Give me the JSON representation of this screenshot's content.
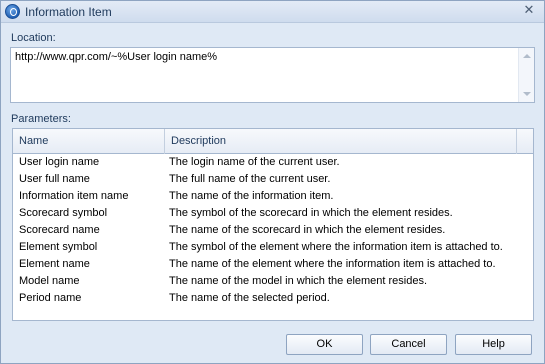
{
  "window": {
    "title": "Information Item"
  },
  "location": {
    "label": "Location:",
    "value": "http://www.qpr.com/~%User login name%"
  },
  "parameters": {
    "label": "Parameters:",
    "columns": {
      "name": "Name",
      "description": "Description"
    },
    "rows": [
      {
        "name": "User login name",
        "description": "The login name of the current user."
      },
      {
        "name": "User full name",
        "description": "The full name of the current user."
      },
      {
        "name": "Information item name",
        "description": "The name of the information item."
      },
      {
        "name": "Scorecard symbol",
        "description": "The symbol of the scorecard in which the element resides."
      },
      {
        "name": "Scorecard name",
        "description": "The name of the scorecard in which the element resides."
      },
      {
        "name": "Element symbol",
        "description": "The symbol of the element where the information item is attached to."
      },
      {
        "name": "Element name",
        "description": "The name of the element where the information item is attached to."
      },
      {
        "name": "Model name",
        "description": "The name of the model in which the element resides."
      },
      {
        "name": "Period name",
        "description": "The name of the selected period."
      }
    ]
  },
  "buttons": {
    "ok": "OK",
    "cancel": "Cancel",
    "help": "Help"
  }
}
